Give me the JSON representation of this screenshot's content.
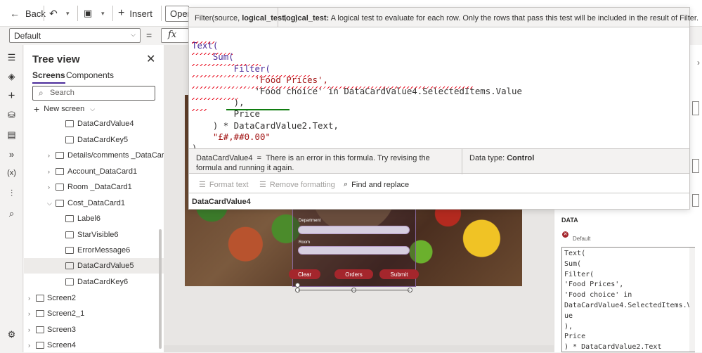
{
  "toolbar": {
    "back_label": "Back",
    "insert_label": "Insert",
    "open_label": "Open S"
  },
  "formula_bar": {
    "property": "Default",
    "equals": "=",
    "fx": "fx"
  },
  "tooltip": {
    "signature_prefix": "Filter(source, ",
    "signature_bold": "logical_test",
    "signature_suffix": ", ...)",
    "param_name": "logical_test:",
    "param_desc": " A logical test to evaluate for each row. Only the rows that pass this test will be included in the result of Filter."
  },
  "editor": {
    "code_lines": [
      "Text(",
      "    Sum(",
      "        Filter(",
      "            'Food Prices',",
      "            'Food choice' in DataCardValue4.SelectedItems.Value",
      "        ),",
      "        Price",
      "    ) * DataCardValue2.Text,",
      "    \"£#,##0.00\"",
      ")"
    ],
    "error_name": "DataCardValue4",
    "error_eq": "=",
    "error_message": "There is an error in this formula. Try revising the formula and running it again.",
    "data_type_label": "Data type:",
    "data_type_value": "Control",
    "tools": {
      "format_text": "Format text",
      "remove_formatting": "Remove formatting",
      "find_replace": "Find and replace"
    },
    "footer": "DataCardValue4"
  },
  "tree": {
    "title": "Tree view",
    "tab_screens": "Screens",
    "tab_components": "Components",
    "search_placeholder": "Search",
    "new_screen": "New screen",
    "items": [
      {
        "label": "DataCardValue4"
      },
      {
        "label": "DataCardKey5"
      },
      {
        "label": "Details/comments _DataCard1"
      },
      {
        "label": "Account_DataCard1"
      },
      {
        "label": "Room _DataCard1"
      },
      {
        "label": "Cost_DataCard1"
      },
      {
        "label": "Label6"
      },
      {
        "label": "StarVisible6"
      },
      {
        "label": "ErrorMessage6"
      },
      {
        "label": "DataCardValue5"
      },
      {
        "label": "DataCardKey6"
      },
      {
        "label": "Screen2"
      },
      {
        "label": "Screen2_1"
      },
      {
        "label": "Screen3"
      },
      {
        "label": "Screen4"
      }
    ]
  },
  "canvas_form": {
    "department_label": "Department",
    "room_label": "Room",
    "buttons": [
      "Clear",
      "Orders",
      "Submit"
    ]
  },
  "right_panel": {
    "section": "DATA",
    "default_label": "Default",
    "code": "Text(\nSum(\nFilter(\n'Food Prices',\n'Food choice' in\nDataCardValue4.SelectedItems.Val\nue\n),\nPrice\n) * DataCardValue2.Text"
  },
  "colors": {
    "accent": "#a4262c",
    "selected_row": "#edebe9",
    "function": "#4b2c9a",
    "string": "#a31515"
  }
}
